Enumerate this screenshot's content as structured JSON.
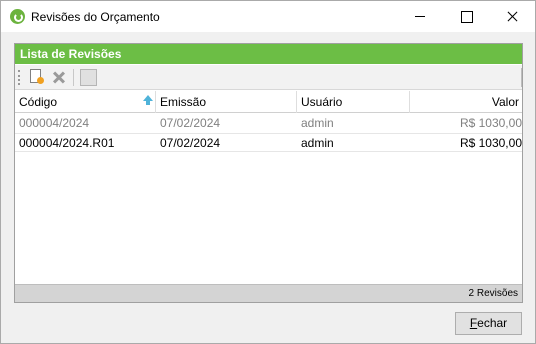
{
  "window": {
    "title": "Revisões do Orçamento"
  },
  "panel": {
    "title": "Lista de Revisões"
  },
  "toolbar": {
    "items": [
      "new-revision",
      "delete-revision",
      "blank"
    ]
  },
  "grid": {
    "columns": [
      "Código",
      "Emissão",
      "Usuário",
      "Valor"
    ],
    "rows": [
      {
        "codigo": "000004/2024",
        "emissao": "07/02/2024",
        "usuario": "admin",
        "valor": "R$ 1030,00"
      },
      {
        "codigo": "000004/2024.R01",
        "emissao": "07/02/2024",
        "usuario": "admin",
        "valor": "R$ 1030,00"
      }
    ]
  },
  "status": {
    "count_text": "2 Revisões"
  },
  "buttons": {
    "close_first": "F",
    "close_rest": "echar"
  },
  "colors": {
    "header_green": "#6cbe45",
    "app_icon_green": "#6cb33e"
  }
}
